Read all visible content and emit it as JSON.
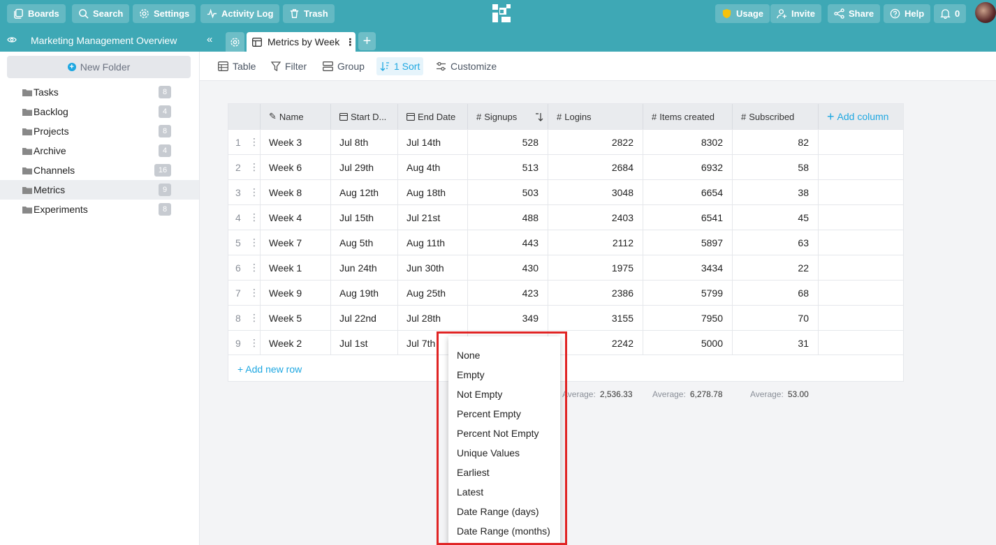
{
  "topbar": {
    "boards": "Boards",
    "search": "Search",
    "settings": "Settings",
    "activity_log": "Activity Log",
    "trash": "Trash",
    "usage": "Usage",
    "invite": "Invite",
    "share": "Share",
    "help": "Help",
    "notifications_count": "0"
  },
  "project": {
    "title": "Marketing Management Overview"
  },
  "tab": {
    "active_label": "Metrics by Week"
  },
  "sidebar": {
    "new_folder": "New Folder",
    "items": [
      {
        "label": "Tasks",
        "count": "8"
      },
      {
        "label": "Backlog",
        "count": "4"
      },
      {
        "label": "Projects",
        "count": "8"
      },
      {
        "label": "Archive",
        "count": "4"
      },
      {
        "label": "Channels",
        "count": "16"
      },
      {
        "label": "Metrics",
        "count": "9",
        "selected": true
      },
      {
        "label": "Experiments",
        "count": "8"
      }
    ]
  },
  "toolbar": {
    "table": "Table",
    "filter": "Filter",
    "group": "Group",
    "sort": "1 Sort",
    "customize": "Customize"
  },
  "table": {
    "columns": [
      "Name",
      "Start D...",
      "End Date",
      "Signups",
      "Logins",
      "Items created",
      "Subscribed"
    ],
    "add_column": "Add column",
    "add_row": "+ Add new row",
    "rows": [
      {
        "n": "1",
        "name": "Week 3",
        "start": "Jul 8th",
        "end": "Jul 14th",
        "signups": "528",
        "logins": "2822",
        "items": "8302",
        "subscribed": "82"
      },
      {
        "n": "2",
        "name": "Week 6",
        "start": "Jul 29th",
        "end": "Aug 4th",
        "signups": "513",
        "logins": "2684",
        "items": "6932",
        "subscribed": "58"
      },
      {
        "n": "3",
        "name": "Week 8",
        "start": "Aug 12th",
        "end": "Aug 18th",
        "signups": "503",
        "logins": "3048",
        "items": "6654",
        "subscribed": "38"
      },
      {
        "n": "4",
        "name": "Week 4",
        "start": "Jul 15th",
        "end": "Jul 21st",
        "signups": "488",
        "logins": "2403",
        "items": "6541",
        "subscribed": "45"
      },
      {
        "n": "5",
        "name": "Week 7",
        "start": "Aug 5th",
        "end": "Aug 11th",
        "signups": "443",
        "logins": "2112",
        "items": "5897",
        "subscribed": "63"
      },
      {
        "n": "6",
        "name": "Week 1",
        "start": "Jun 24th",
        "end": "Jun 30th",
        "signups": "430",
        "logins": "1975",
        "items": "3434",
        "subscribed": "22"
      },
      {
        "n": "7",
        "name": "Week 9",
        "start": "Aug 19th",
        "end": "Aug 25th",
        "signups": "423",
        "logins": "2386",
        "items": "5799",
        "subscribed": "68"
      },
      {
        "n": "8",
        "name": "Week 5",
        "start": "Jul 22nd",
        "end": "Jul 28th",
        "signups": "349",
        "logins": "3155",
        "items": "7950",
        "subscribed": "70"
      },
      {
        "n": "9",
        "name": "Week 2",
        "start": "Jul 1st",
        "end": "Jul 7th",
        "signups": "",
        "logins": "2242",
        "items": "5000",
        "subscribed": "31"
      }
    ],
    "summary": {
      "label": "Average:",
      "logins": "2,536.33",
      "items": "6,278.78",
      "subscribed": "53.00"
    }
  },
  "dropdown": {
    "options": [
      "None",
      "Empty",
      "Not Empty",
      "Percent Empty",
      "Percent Not Empty",
      "Unique Values",
      "Earliest",
      "Latest",
      "Date Range (days)",
      "Date Range (months)"
    ]
  },
  "colors": {
    "brand": "#3ea8b5",
    "accent": "#1ea7e1",
    "usage_icon": "#f6c20a",
    "highlight": "#e02424"
  }
}
